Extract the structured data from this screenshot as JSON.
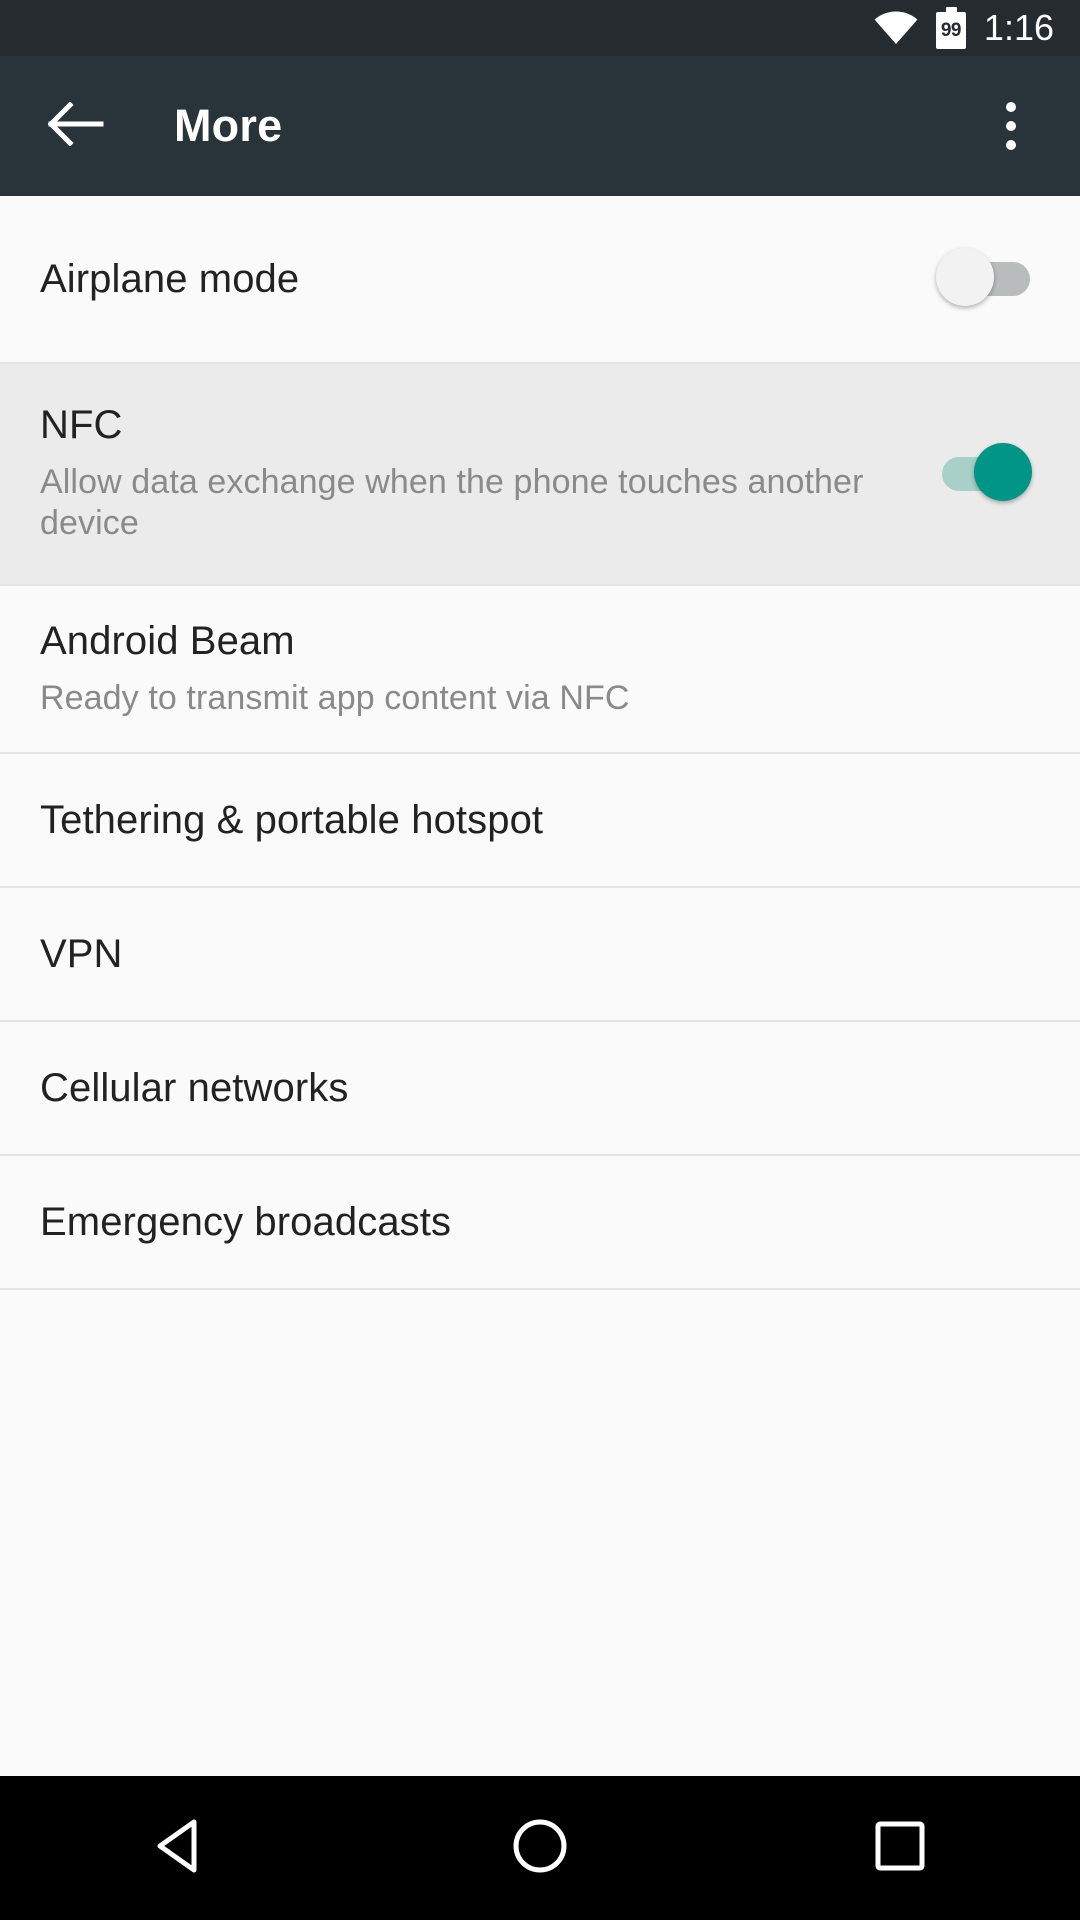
{
  "status_bar": {
    "wifi_icon": "wifi-icon",
    "battery_icon": "battery-icon",
    "battery_level": "99",
    "time": "1:16",
    "background_color": "#252b2e",
    "foreground_color": "#ffffff"
  },
  "app_bar": {
    "back_icon": "arrow-back-icon",
    "title": "More",
    "overflow_icon": "overflow-menu-icon",
    "background_color": "#28343a"
  },
  "settings_list": {
    "rows": [
      {
        "title": "Airplane mode",
        "summary": "",
        "control": "switch",
        "switch_state": "off",
        "highlighted": false
      },
      {
        "title": "NFC",
        "summary": "Allow data exchange when the phone touches another device",
        "control": "switch",
        "switch_state": "on",
        "highlighted": true
      },
      {
        "title": "Android Beam",
        "summary": "Ready to transmit app content via NFC",
        "control": "none",
        "switch_state": "",
        "highlighted": false
      },
      {
        "title": "Tethering & portable hotspot",
        "summary": "",
        "control": "none",
        "switch_state": "",
        "highlighted": false
      },
      {
        "title": "VPN",
        "summary": "",
        "control": "none",
        "switch_state": "",
        "highlighted": false
      },
      {
        "title": "Cellular networks",
        "summary": "",
        "control": "none",
        "switch_state": "",
        "highlighted": false
      },
      {
        "title": "Emergency broadcasts",
        "summary": "",
        "control": "none",
        "switch_state": "",
        "highlighted": false
      }
    ]
  },
  "nav_bar": {
    "back_icon": "nav-back-triangle-icon",
    "home_icon": "nav-home-circle-icon",
    "recents_icon": "nav-recents-square-icon",
    "background_color": "#000000"
  },
  "colors": {
    "switch_on_thumb": "#009587",
    "switch_on_track": "#a9cfc9",
    "switch_off_thumb": "#f2f2f2",
    "switch_off_track": "#b9bcbd",
    "row_highlight": "#ebebeb",
    "list_background": "#fafafa"
  }
}
